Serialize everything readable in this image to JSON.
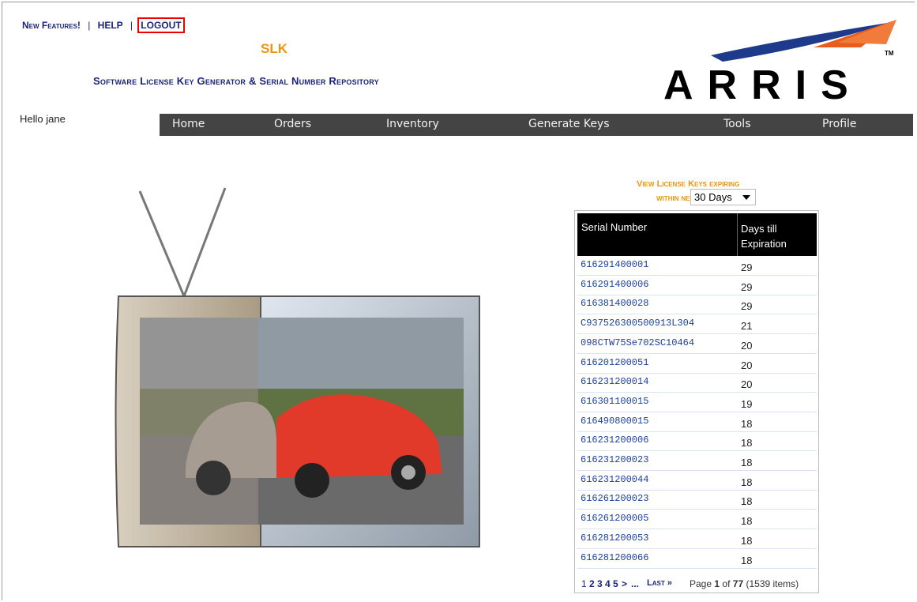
{
  "toplinks": {
    "new_features": "New Features!",
    "sep1": "|",
    "help": "HELP",
    "sep2": "|",
    "logout": "LOGOUT"
  },
  "brand": {
    "short": "SLK",
    "subtitle": "Software License Key Generator & Serial Number Repository",
    "logo_text": "ARRIS",
    "tm": "TM"
  },
  "greeting": "Hello jane",
  "nav": [
    "Home",
    "Orders",
    "Inventory",
    "Generate Keys",
    "Tools",
    "Profile"
  ],
  "expiring": {
    "line1": "View License Keys expiring",
    "line2": "within next",
    "selected": "30 Days"
  },
  "table": {
    "col1": "Serial Number",
    "col2_line1": "Days till",
    "col2_line2": "Expiration",
    "rows": [
      {
        "serial": "616291400001",
        "days": "29"
      },
      {
        "serial": "616291400006",
        "days": "29"
      },
      {
        "serial": "616381400028",
        "days": "29"
      },
      {
        "serial": "C937526300500913L304",
        "days": "21"
      },
      {
        "serial": "098CTW75Se702SC10464",
        "days": "20"
      },
      {
        "serial": "616201200051",
        "days": "20"
      },
      {
        "serial": "616231200014",
        "days": "20"
      },
      {
        "serial": "616301100015",
        "days": "19"
      },
      {
        "serial": "616490800015",
        "days": "18"
      },
      {
        "serial": "616231200006",
        "days": "18"
      },
      {
        "serial": "616231200023",
        "days": "18"
      },
      {
        "serial": "616231200044",
        "days": "18"
      },
      {
        "serial": "616261200023",
        "days": "18"
      },
      {
        "serial": "616261200005",
        "days": "18"
      },
      {
        "serial": "616281200053",
        "days": "18"
      },
      {
        "serial": "616281200066",
        "days": "18"
      }
    ]
  },
  "pager": {
    "pages": [
      "1",
      "2",
      "3",
      "4",
      "5"
    ],
    "next": ">",
    "ellipsis": "...",
    "last": "Last »",
    "info_prefix": "Page",
    "current": "1",
    "of": "of",
    "total": "77",
    "items": "(1539 items)"
  },
  "colors": {
    "navy": "#1a237e",
    "orange": "#f29410",
    "nav_bg": "#444444",
    "logo_blue": "#1e3a8a",
    "logo_orange": "#e85d1c"
  }
}
